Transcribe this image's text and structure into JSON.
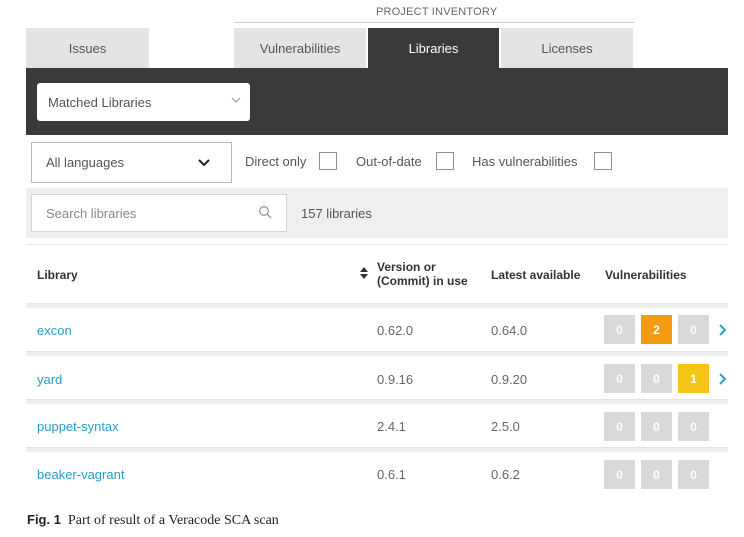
{
  "header": {
    "section_title": "PROJECT INVENTORY"
  },
  "tabs": [
    {
      "label": "Issues",
      "active": false
    },
    {
      "label": "Vulnerabilities",
      "active": false
    },
    {
      "label": "Libraries",
      "active": true
    },
    {
      "label": "Licenses",
      "active": false
    }
  ],
  "filters": {
    "match_select": "Matched Libraries",
    "language_select": "All languages",
    "checkboxes": [
      {
        "label": "Direct only",
        "checked": false
      },
      {
        "label": "Out-of-date",
        "checked": false
      },
      {
        "label": "Has vulnerabilities",
        "checked": false
      }
    ]
  },
  "search": {
    "placeholder": "Search libraries",
    "count_text": "157 libraries"
  },
  "table": {
    "columns": [
      "Library",
      "Version or",
      "(Commit) in use",
      "Latest available",
      "Vulnerabilities"
    ],
    "rows": [
      {
        "name": "excon",
        "version": "0.62.0",
        "latest": "0.64.0",
        "vulns": [
          "0",
          "2",
          "0"
        ],
        "has_chevron": true
      },
      {
        "name": "yard",
        "version": "0.9.16",
        "latest": "0.9.20",
        "vulns": [
          "0",
          "0",
          "1"
        ],
        "has_chevron": true
      },
      {
        "name": "puppet-syntax",
        "version": "2.4.1",
        "latest": "2.5.0",
        "vulns": [
          "0",
          "0",
          "0"
        ],
        "has_chevron": false
      },
      {
        "name": "beaker-vagrant",
        "version": "0.6.1",
        "latest": "0.6.2",
        "vulns": [
          "0",
          "0",
          "0"
        ],
        "has_chevron": false
      }
    ]
  },
  "colors": {
    "dark_bar": "#3a3a3a",
    "link": "#27a0c6",
    "badge_zero": "#d9d9d9",
    "badge_high": "#f39c12",
    "badge_medium": "#f5c518"
  },
  "icons": [
    "chevron-down-icon",
    "search-icon",
    "sort-icon",
    "chevron-right-icon"
  ],
  "caption": {
    "label": "Fig. 1",
    "text": "Part of result of a Veracode SCA scan"
  }
}
